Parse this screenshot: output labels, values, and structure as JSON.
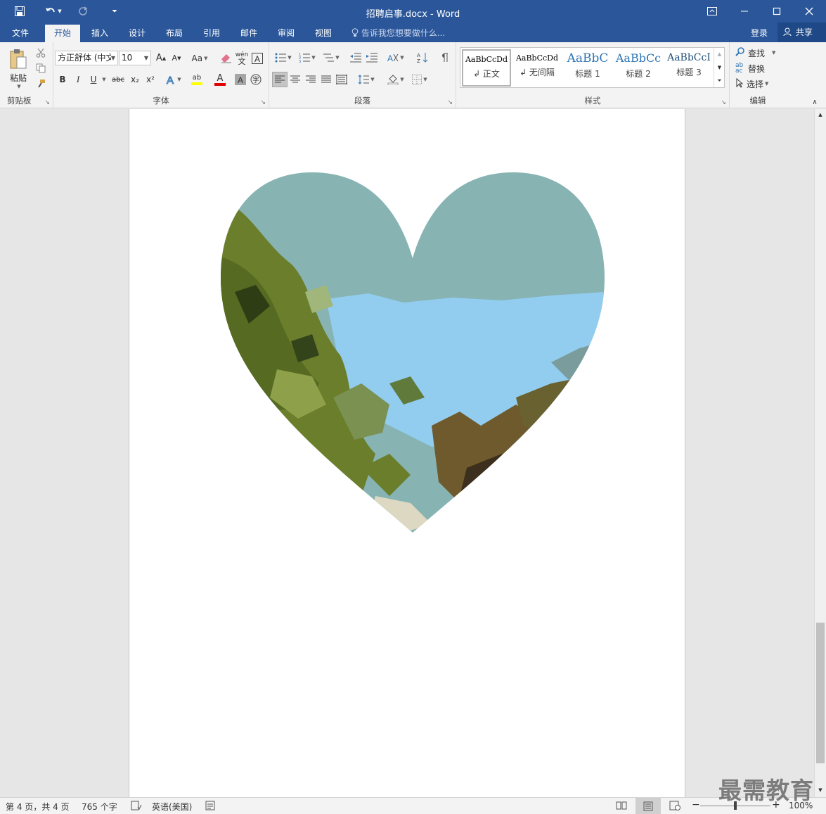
{
  "app": {
    "document_title": "招聘启事.docx - Word"
  },
  "quick_access": {
    "save_icon": "save-icon",
    "undo_icon": "undo-icon",
    "redo_icon": "redo-icon",
    "customize_icon": "customize-qat-icon"
  },
  "tabs": [
    {
      "label": "文件"
    },
    {
      "label": "开始"
    },
    {
      "label": "插入"
    },
    {
      "label": "设计"
    },
    {
      "label": "布局"
    },
    {
      "label": "引用"
    },
    {
      "label": "邮件"
    },
    {
      "label": "审阅"
    },
    {
      "label": "视图"
    }
  ],
  "active_tab": "开始",
  "tell_me": "告诉我您想要做什么...",
  "account": {
    "login": "登录",
    "share": "共享"
  },
  "ribbon": {
    "clipboard": {
      "paste": "粘贴",
      "label": "剪贴板"
    },
    "font": {
      "font_name": "方正舒体 (中文",
      "font_size": "10",
      "change_case": "Aa",
      "bold": "B",
      "italic": "I",
      "underline": "U",
      "strike": "abc",
      "subscript": "x₂",
      "superscript": "x²",
      "font_color_letter": "A",
      "label": "字体",
      "highlight_color": "#ffff00",
      "font_color": "#e00000"
    },
    "paragraph": {
      "label": "段落"
    },
    "styles": {
      "items": [
        {
          "sample": "AaBbCcDd",
          "name": "↲ 正文"
        },
        {
          "sample": "AaBbCcDd",
          "name": "↲ 无间隔"
        },
        {
          "sample": "AaBbC",
          "name": "标题 1"
        },
        {
          "sample": "AaBbCc",
          "name": "标题 2"
        },
        {
          "sample": "AaBbCcI",
          "name": "标题 3"
        }
      ],
      "label": "样式"
    },
    "editing": {
      "find": "查找",
      "replace": "替换",
      "select": "选择",
      "label": "编辑"
    }
  },
  "status": {
    "page": "第 4 页，共 4 页",
    "words": "765 个字",
    "language": "英语(美国)",
    "zoom": "100%",
    "zoom_level": 1.0
  },
  "watermark": "最需教育",
  "colors": {
    "title_bar": "#2b579a",
    "ribbon": "#f3f3f3",
    "heading_blue": "#2e74b5"
  }
}
